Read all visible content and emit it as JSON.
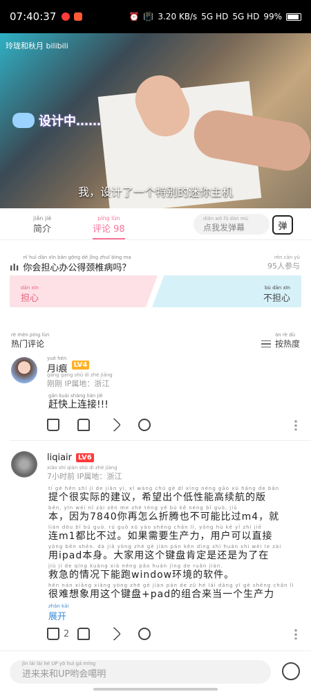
{
  "status_bar": {
    "time": "07:40:37",
    "net_speed": "3.20 KB/s",
    "signal1": "5G HD",
    "signal2": "5G HD",
    "battery": "99%",
    "indicator_colors": [
      "#ff3b3b",
      "#ff5a36"
    ]
  },
  "video": {
    "watermark": "玲珑和秋月 bilibili",
    "overlay": "设计中……",
    "subtitle": "我，设计了一个特别的迷你主机"
  },
  "tabs": {
    "intro": {
      "label": "简介",
      "pinyin": "jiǎn jiè"
    },
    "comments": {
      "label": "评论 98",
      "pinyin": "píng lùn"
    },
    "danmaku_placeholder": "点我发弹幕",
    "danmaku_pinyin": "diǎn wǒ fā dàn mù",
    "danmaku_button": "弹"
  },
  "poll": {
    "question": "你会担心办公得颈椎病吗？",
    "question_pinyin": "nǐ huì dān xīn bàn gōng dé jǐng zhuī bìng ma",
    "participants": "95人参与",
    "participants_pinyin": "rén cān yù",
    "option_worried": "担心",
    "option_worried_pinyin": "dān xīn",
    "option_not_worried": "不担心",
    "option_not_worried_pinyin": "bù dān xīn"
  },
  "hot_comments": {
    "title": "热门评论",
    "title_pinyin": "rè mén píng lùn",
    "sort_label": "按热度",
    "sort_pinyin": "àn rè dù"
  },
  "comments": [
    {
      "username": "月i痕",
      "username_pinyin": "yuè hén",
      "level": "LV4",
      "time": "刚刚",
      "location": "IP属地：浙江",
      "meta_pinyin": "gāng gāng shǔ dì zhè jiāng",
      "text": "赶快上连接!!!",
      "text_pinyin": "gǎn kuài shàng lián jiē",
      "likes": ""
    },
    {
      "username": "liqiair",
      "level": "LV6",
      "time": "7小时前",
      "location": "IP属地：浙江",
      "meta_pinyin": "xiǎo shí qián shǔ dì zhè jiāng",
      "text_lines": [
        "提个很实际的建议，希望出个低性能高续航的版",
        "本，因为7840你再怎么折腾也不可能比过m4，就",
        "连m1都比不过。如果需要生产力，用户可以直接",
        "用ipad本身。大家用这个键盘肯定是还是为了在",
        "救急的情况下能跑window环境的软件。",
        "很难想象用这个键盘+pad的组合来当一个生产力"
      ],
      "line_pinyin": [
        "tí gè hěn shí jì de jiàn yì, xī wàng chū gè dī xìng néng gāo xù háng de bǎn",
        "běn, yīn wèi nǐ zài zěn me zhé téng yě bù kě néng bǐ guò, jiù",
        "lián dōu bǐ bú guò. rú guǒ xū yào shēng chǎn lì, yòng hù kě yǐ zhí jiē",
        "yòng běn shēn. dà jiā yòng zhè gè jiàn pán kěn dìng shì huán shì wèi le zài",
        "jiù jí de qíng kuàng xià néng pǎo huán jìng de ruǎn jiàn.",
        "hěn nán xiǎng xiàng yòng zhè gè jiàn pán de zǔ hé lái dāng yī gè shēng chǎn lì"
      ],
      "expand": "展开",
      "expand_pinyin": "zhǎn kāi",
      "likes": "2"
    }
  ],
  "bottom": {
    "placeholder": "进来来和UP哟会噶明",
    "placeholder_pinyin": "jìn lái lái hé  UP yō huì gá míng"
  }
}
